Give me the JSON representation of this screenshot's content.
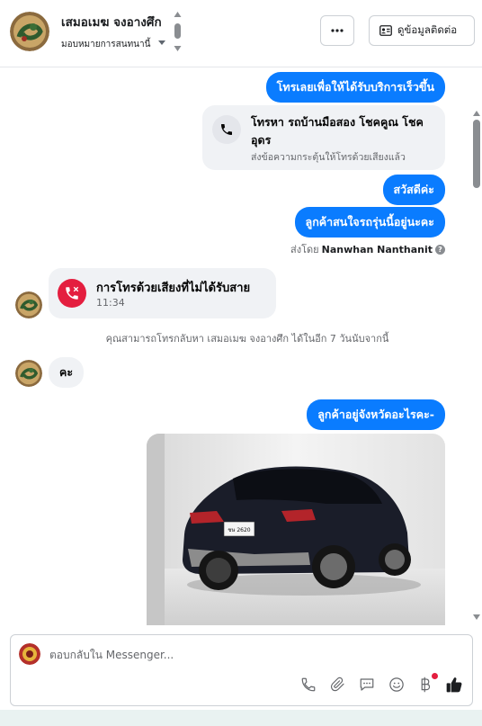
{
  "header": {
    "contact_name": "เสมอเมฆ จงอางศึก",
    "assign_label": "มอบหมายการสนทนานี้",
    "more_label": "···",
    "contact_info_label": "ดูข้อมูลติดต่อ"
  },
  "messages": {
    "out1": "โทรเลยเพื่อให้ได้รับบริการเร็วขึ้น",
    "call_card": {
      "title": "โทรหา รถบ้านมือสอง โชคคูณ โชคอุดร",
      "subtitle": "ส่งข้อความกระตุ้นให้โทรด้วยเสียงแล้ว"
    },
    "out2": "สวัสดีค่ะ",
    "out3": "ลูกค้าสนใจรถรุ่นนี้อยู่นะคะ",
    "sent_by_prefix": "ส่งโดย",
    "sent_by_name": "Nanwhan Nanthanit",
    "help_mark": "?",
    "missed_call": {
      "title": "การโทรด้วยเสียงที่ไม่ได้รับสาย",
      "time": "11:34"
    },
    "callback_note": "คุณสามารถโทรกลับหา เสมอเมฆ จงอางศึก ได้ในอีก 7 วันนับจากนี้",
    "in1": "คะ",
    "out4": "ลูกค้าอยู่จังหวัดอะไรคะ-",
    "plate_text": "ชษ 2620"
  },
  "composer": {
    "placeholder": "ตอบกลับใน Messenger..."
  },
  "colors": {
    "outgoing_bubble": "#0a7cff",
    "incoming_bubble": "#f0f2f5",
    "missed_call": "#e41e3f",
    "like": "#1c1e21"
  }
}
